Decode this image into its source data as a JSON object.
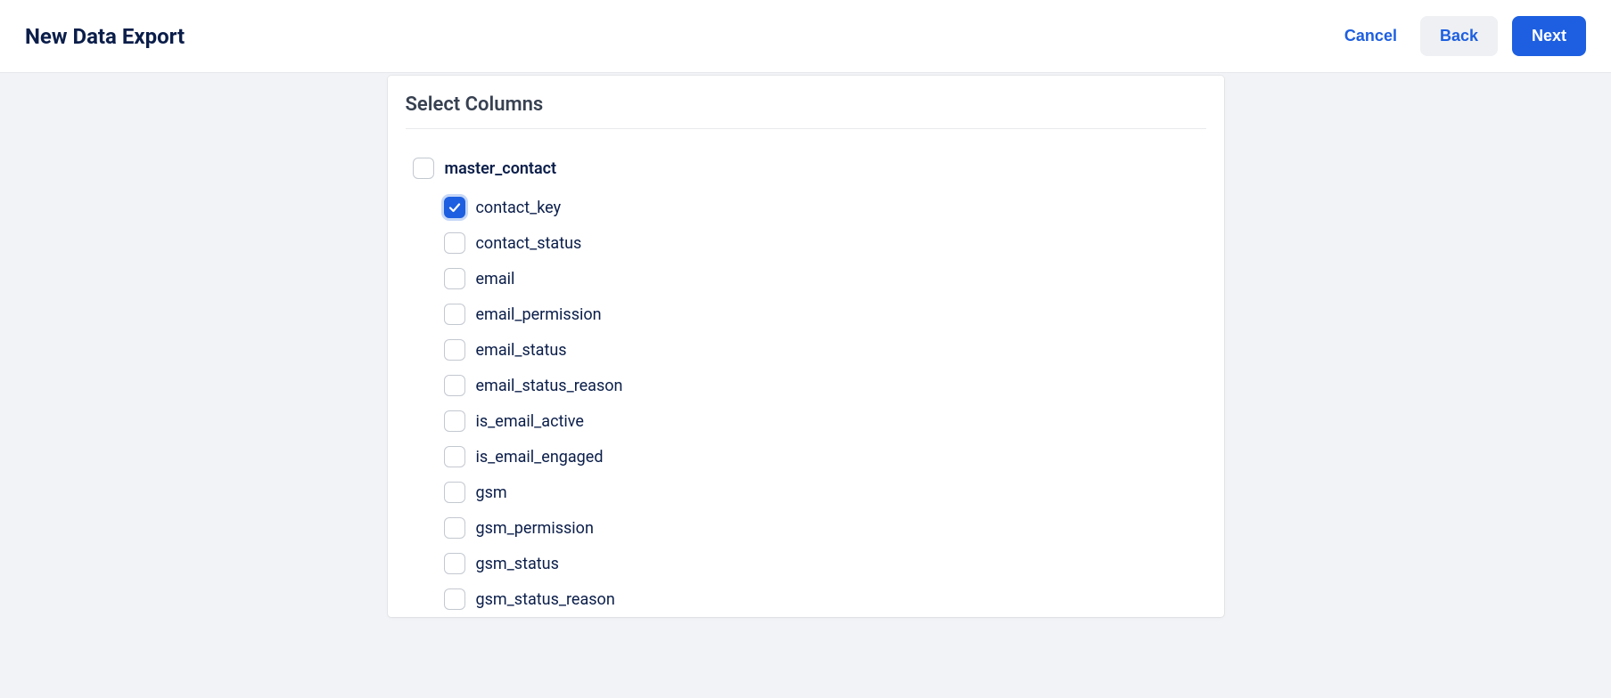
{
  "header": {
    "title": "New Data Export",
    "cancel_label": "Cancel",
    "back_label": "Back",
    "next_label": "Next"
  },
  "card": {
    "title": "Select Columns",
    "parent": {
      "label": "master_contact",
      "checked": false
    },
    "children": [
      {
        "label": "contact_key",
        "checked": true
      },
      {
        "label": "contact_status",
        "checked": false
      },
      {
        "label": "email",
        "checked": false
      },
      {
        "label": "email_permission",
        "checked": false
      },
      {
        "label": "email_status",
        "checked": false
      },
      {
        "label": "email_status_reason",
        "checked": false
      },
      {
        "label": "is_email_active",
        "checked": false
      },
      {
        "label": "is_email_engaged",
        "checked": false
      },
      {
        "label": "gsm",
        "checked": false
      },
      {
        "label": "gsm_permission",
        "checked": false
      },
      {
        "label": "gsm_status",
        "checked": false
      },
      {
        "label": "gsm_status_reason",
        "checked": false
      }
    ]
  }
}
